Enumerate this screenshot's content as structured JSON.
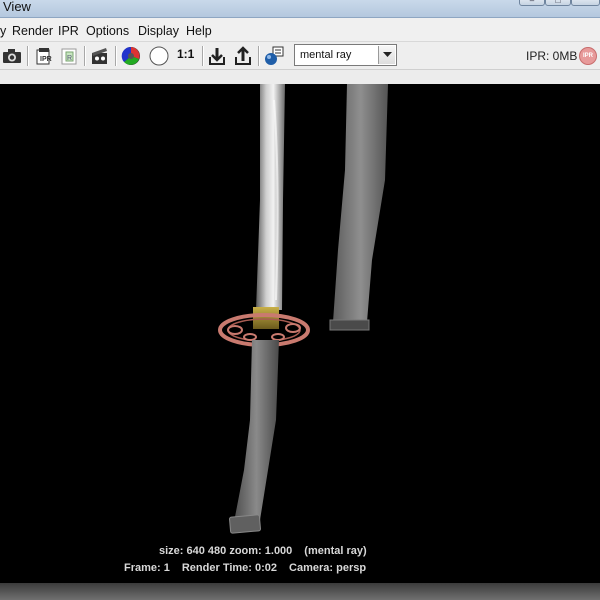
{
  "window": {
    "title": "View"
  },
  "menu": {
    "render_edge": "y",
    "items": [
      "Render",
      "IPR",
      "Options",
      "Display",
      "Help"
    ]
  },
  "toolbar": {
    "one_to_one_label": "1:1",
    "renderer": {
      "selected": "mental ray"
    },
    "ipr_status": "IPR: 0MB",
    "ipr_badge": "IPR",
    "icons": [
      "camera-icon",
      "ipr-render-icon",
      "refresh-region-icon",
      "render-sequence-icon",
      "color-channels-icon",
      "alpha-channel-icon",
      "keep-image-icon",
      "remove-image-icon",
      "render-settings-icon"
    ]
  },
  "render_info": {
    "size_text": "size:  640  480 zoom: 1.000",
    "renderer_text": "(mental ray)",
    "frame_text": "Frame: 1",
    "time_text": "Render Time: 0:02",
    "camera_text": "Camera: persp"
  },
  "colors": {
    "viewport_bg": "#000000",
    "toolbar_bg": "#eeeeee",
    "tsuba_color": "#c97a6f",
    "habaki_color": "#a08a2c",
    "sword_grey": "#8c8c8c"
  }
}
